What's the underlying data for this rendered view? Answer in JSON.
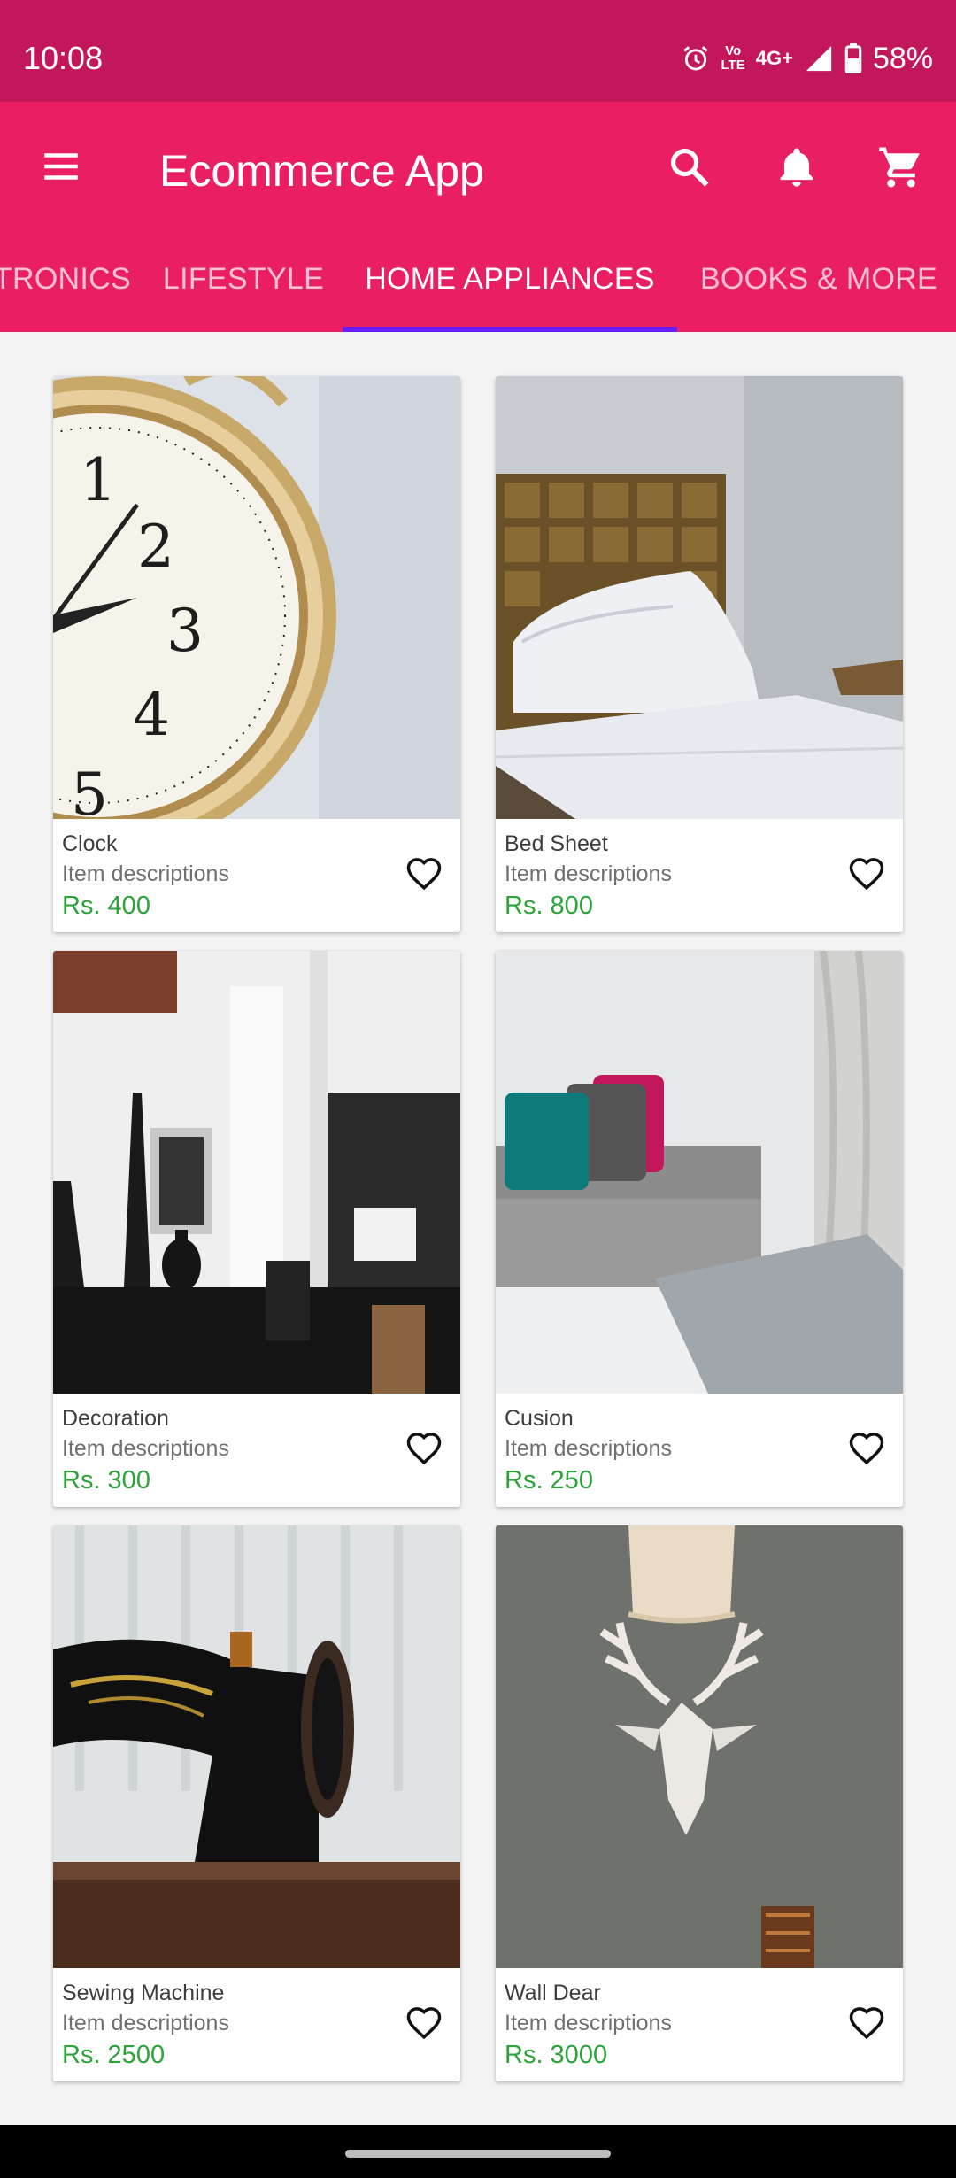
{
  "status_bar": {
    "time": "10:08",
    "network": "4G+",
    "volte_top": "Vo",
    "volte_bottom": "LTE",
    "battery": "58%"
  },
  "toolbar": {
    "title": "Ecommerce App",
    "icons": [
      "menu-icon",
      "search-icon",
      "bell-icon",
      "cart-icon"
    ]
  },
  "tabs": [
    {
      "label": "TRONICS",
      "active": false
    },
    {
      "label": "LIFESTYLE",
      "active": false
    },
    {
      "label": "HOME APPLIANCES",
      "active": true
    },
    {
      "label": "BOOKS & MORE",
      "active": false
    }
  ],
  "products": [
    {
      "name": "Clock",
      "description": "Item descriptions",
      "price": "Rs. 400"
    },
    {
      "name": "Bed Sheet",
      "description": "Item descriptions",
      "price": "Rs. 800"
    },
    {
      "name": "Decoration",
      "description": "Item descriptions",
      "price": "Rs. 300"
    },
    {
      "name": "Cusion",
      "description": "Item descriptions",
      "price": "Rs. 250"
    },
    {
      "name": "Sewing Machine",
      "description": "Item descriptions",
      "price": "Rs. 2500"
    },
    {
      "name": "Wall Dear",
      "description": "Item descriptions",
      "price": "Rs. 3000"
    }
  ],
  "colors": {
    "status_bar": "#c2185b",
    "app_bar": "#e91e63",
    "tab_indicator": "#651fff",
    "price": "#2ea33a",
    "background": "#f3f3f3"
  }
}
